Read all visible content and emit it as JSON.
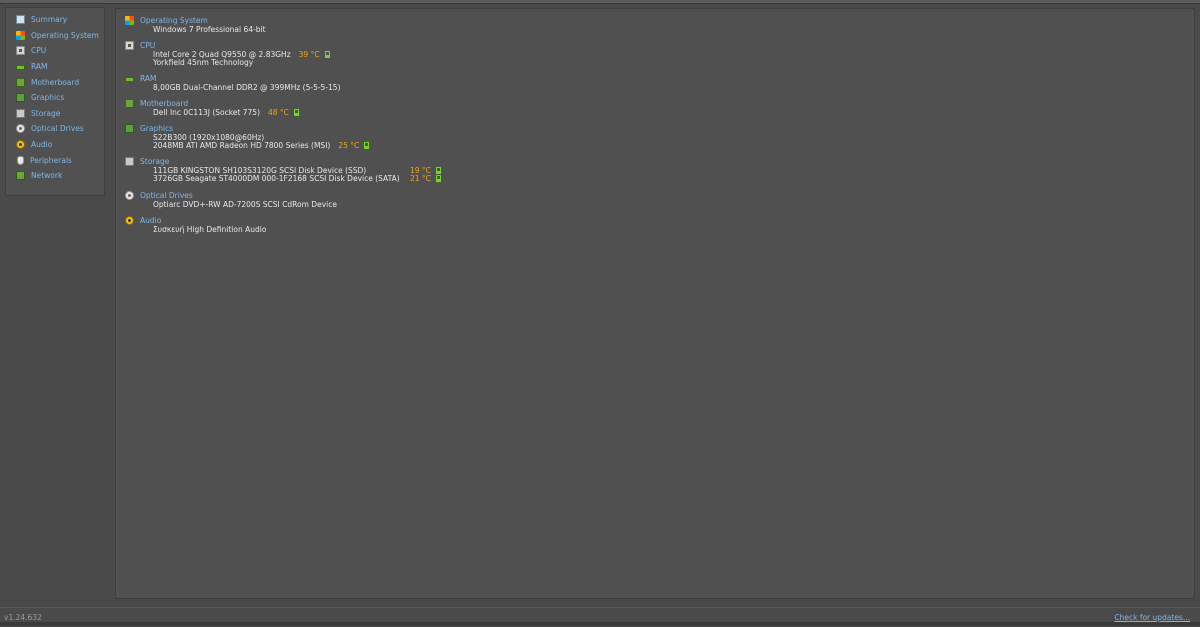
{
  "sidebar": {
    "items": [
      {
        "label": "Summary",
        "icon": "summary-icon"
      },
      {
        "label": "Operating System",
        "icon": "windows-logo-icon"
      },
      {
        "label": "CPU",
        "icon": "cpu-chip-icon"
      },
      {
        "label": "RAM",
        "icon": "ram-module-icon"
      },
      {
        "label": "Motherboard",
        "icon": "motherboard-icon"
      },
      {
        "label": "Graphics",
        "icon": "graphics-card-icon"
      },
      {
        "label": "Storage",
        "icon": "hard-drive-icon"
      },
      {
        "label": "Optical Drives",
        "icon": "optical-disc-icon"
      },
      {
        "label": "Audio",
        "icon": "speaker-icon"
      },
      {
        "label": "Peripherals",
        "icon": "mouse-icon"
      },
      {
        "label": "Network",
        "icon": "network-icon"
      }
    ]
  },
  "summary": {
    "os": {
      "title": "Operating System",
      "line1": "Windows 7 Professional 64-bit"
    },
    "cpu": {
      "title": "CPU",
      "line1": "Intel Core 2 Quad Q9550 @ 2.83GHz",
      "temp": "39 °C",
      "line2": "Yorkfield 45nm Technology"
    },
    "ram": {
      "title": "RAM",
      "line1": "8,00GB Dual-Channel DDR2 @ 399MHz (5-5-5-15)"
    },
    "motherboard": {
      "title": "Motherboard",
      "line1": "Dell Inc 0C113J (Socket 775)",
      "temp": "48 °C"
    },
    "graphics": {
      "title": "Graphics",
      "line1": "S22B300 (1920x1080@60Hz)",
      "line2": "2048MB ATI AMD Radeon HD 7800 Series (MSI)",
      "temp": "25 °C"
    },
    "storage": {
      "title": "Storage",
      "drives": [
        {
          "name": "111GB KINGSTON SH103S3120G SCSI Disk Device (SSD)",
          "temp": "19 °C"
        },
        {
          "name": "3726GB Seagate ST4000DM 000-1F2168 SCSI Disk Device (SATA)",
          "temp": "21 °C"
        }
      ]
    },
    "optical": {
      "title": "Optical Drives",
      "line1": "Optiarc DVD+-RW AD-7200S SCSI CdRom Device"
    },
    "audio": {
      "title": "Audio",
      "line1": "Συσκευή High Definition Audio"
    }
  },
  "footer": {
    "version": "v1.24.632",
    "check_updates": "Check for updates..."
  },
  "colors": {
    "background": "#4a4a4a",
    "accent_text": "#7fb6e6",
    "temperature": "#f2a417",
    "gauge": "#74d81f"
  }
}
